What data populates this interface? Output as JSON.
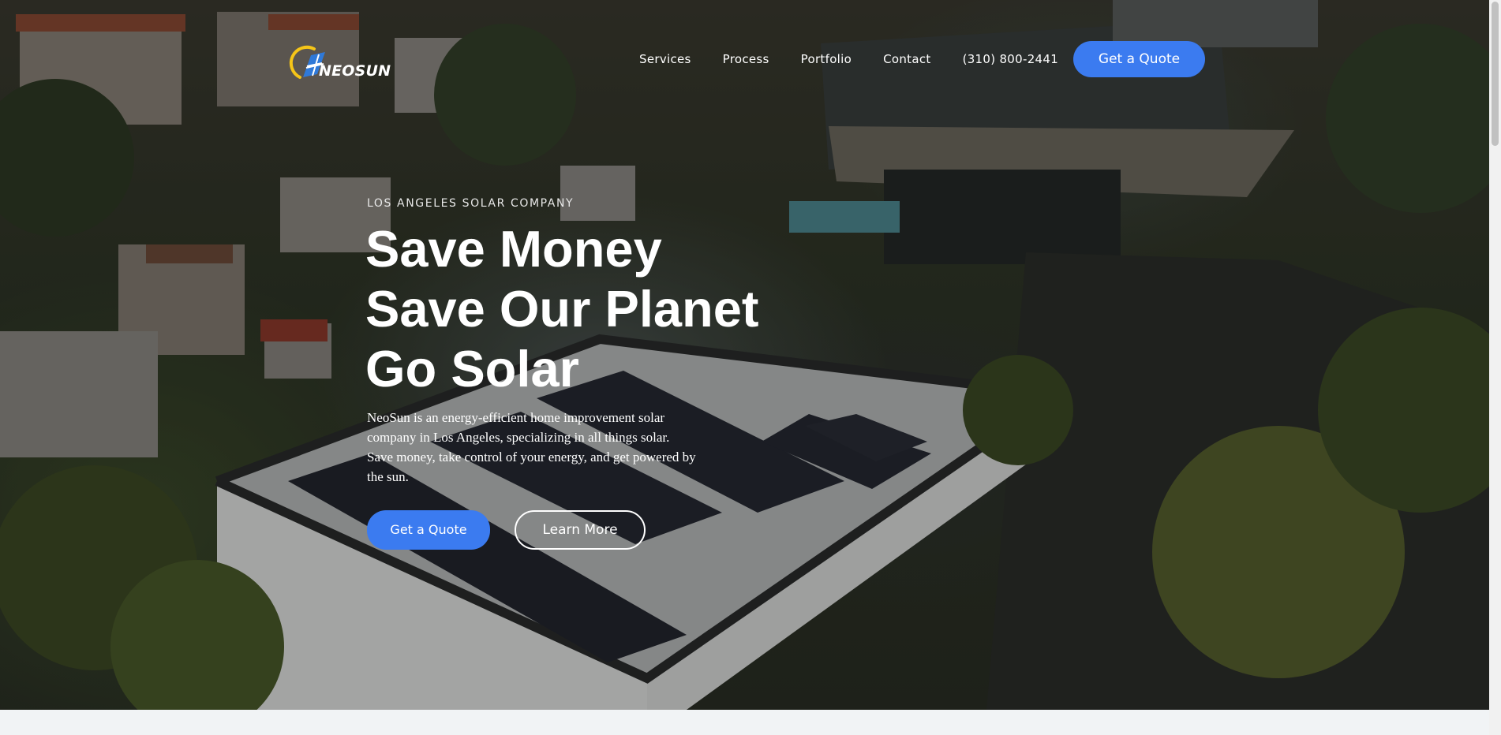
{
  "brand": {
    "name": "NEOSUN",
    "logo_icon": "sun-panel-logo-icon",
    "accent_color": "#3b7bf0",
    "sun_color": "#f5c518"
  },
  "nav": {
    "items": [
      {
        "label": "Services"
      },
      {
        "label": "Process"
      },
      {
        "label": "Portfolio"
      },
      {
        "label": "Contact"
      },
      {
        "label": "(310) 800-2441"
      }
    ],
    "cta_label": "Get a Quote"
  },
  "hero": {
    "kicker": "LOS ANGELES SOLAR COMPANY",
    "headline": [
      "Save Money",
      "Save Our Planet",
      "Go Solar"
    ],
    "description": "NeoSun is an energy-efficient home improvement solar company in Los Angeles, specializing in all things solar. Save money, take control of your energy, and get powered by the sun.",
    "primary_cta": "Get a Quote",
    "secondary_cta": "Learn More",
    "background_image": "aerial-house-solar-roof-photo"
  }
}
